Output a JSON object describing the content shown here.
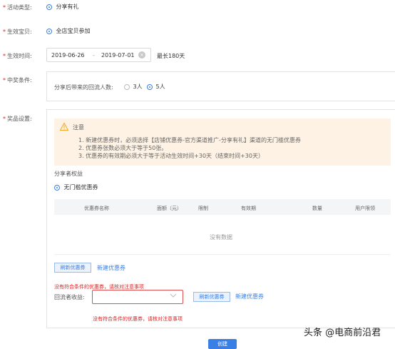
{
  "activity_type": {
    "label": "活动类型:",
    "option": "分享有礼"
  },
  "effective_item": {
    "label": "生效宝贝:",
    "option": "全店宝贝参加"
  },
  "effective_time": {
    "label": "生效时间:",
    "start": "2019-06-26",
    "separator": "-",
    "end": "2019-07-01",
    "hint": "最长180天"
  },
  "prize_condition": {
    "label": "中奖条件:",
    "text": "分享后带来的回流人数:",
    "options": [
      "3人",
      "5人"
    ],
    "selected": 1
  },
  "prize_settings": {
    "label": "奖品设置:",
    "notice": {
      "title": "注意",
      "lines": [
        "1. 新建优惠券时，必须选择【店铺优惠券-官方渠道推广-分享有礼】渠道的无门槛优惠券",
        "2. 优惠券张数必须大于等于50张。",
        "3. 优惠券的有效期必须大于等于活动生效时间+30天（结束时间+30天）"
      ]
    },
    "sharer_rights_label": "分享者权益",
    "coupon_option": "无门槛优惠券",
    "table": {
      "headers": [
        "优惠券名称",
        "面额（元）",
        "限制",
        "有效期",
        "数量",
        "用户限领"
      ],
      "empty_text": "没有数据"
    },
    "refresh_button": "刷新优惠券",
    "new_coupon_link": "新建优惠券",
    "error_no_match": "没有符合条件的优惠券，请核对注意事项",
    "returner_label": "回流者收益:",
    "returner_select_placeholder": "",
    "returner_refresh_button": "刷新优惠券",
    "returner_new_link": "新建优惠券",
    "returner_error": "没有符合条件的优惠券，请核对注意事项"
  },
  "create_button": "创建",
  "watermark": "头条 @电商前沿君",
  "colors": {
    "accent": "#3a7fe6",
    "error": "#e02020",
    "notice_bg": "#fdf2e4",
    "warning_icon": "#f5a623"
  }
}
